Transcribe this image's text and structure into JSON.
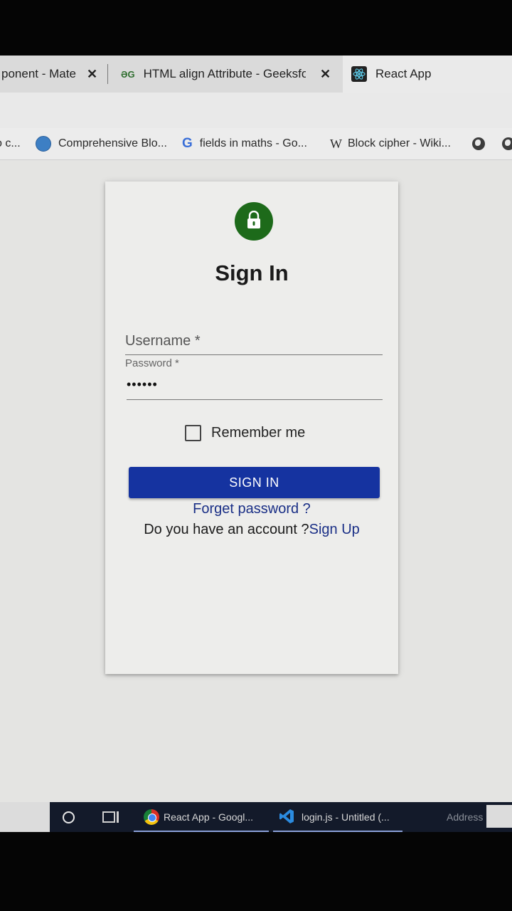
{
  "browser": {
    "tabs": [
      {
        "title": "ponent - Mate"
      },
      {
        "title": "HTML align Attribute - GeeksforG"
      },
      {
        "title": "React App"
      }
    ],
    "bookmarks": [
      {
        "label": "o c...",
        "icon": "generic-icon"
      },
      {
        "label": "Comprehensive Blo...",
        "icon": "globe-blue-icon"
      },
      {
        "label": "fields in maths - Go...",
        "icon": "google-icon"
      },
      {
        "label": "Block cipher - Wiki...",
        "icon": "wikipedia-icon"
      },
      {
        "label": "",
        "icon": "globe-icon"
      },
      {
        "label": "",
        "icon": "globe-icon"
      }
    ]
  },
  "login": {
    "title": "Sign In",
    "username_label": "Username *",
    "password_label": "Password *",
    "password_value": "••••••",
    "remember_label": "Remember me",
    "remember_checked": false,
    "signin_label": "SIGN IN",
    "forget_link": "Forget password ?",
    "account_prompt": "Do you have an account ?",
    "signup_link": "Sign Up"
  },
  "taskbar": {
    "items": [
      {
        "label": "React App - Googl..."
      },
      {
        "label": "login.js - Untitled (..."
      }
    ],
    "address_label": "Address"
  },
  "colors": {
    "avatar_bg": "#1d6a1a",
    "button_bg": "#1533a0",
    "link": "#1a2f86"
  }
}
